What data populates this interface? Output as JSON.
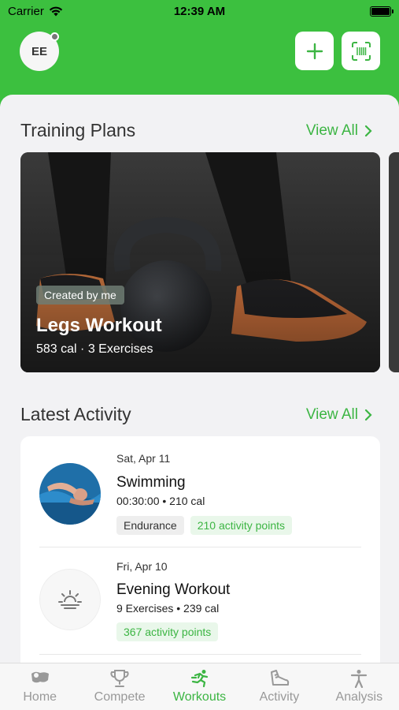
{
  "status_bar": {
    "carrier": "Carrier",
    "time": "12:39 AM"
  },
  "header": {
    "avatar_initials": "EE",
    "add_icon": "plus-icon",
    "scan_icon": "barcode-scan-icon"
  },
  "training_plans": {
    "title": "Training Plans",
    "view_all": "View All",
    "card": {
      "badge": "Created by me",
      "name": "Legs Workout",
      "meta": "583 cal · 3 Exercises"
    }
  },
  "latest_activity": {
    "title": "Latest Activity",
    "view_all": "View All",
    "items": [
      {
        "date": "Sat, Apr 11",
        "name": "Swimming",
        "meta": "00:30:00 • 210 cal",
        "tags": [
          "Endurance",
          "210 activity points"
        ]
      },
      {
        "date": "Fri, Apr 10",
        "name": "Evening Workout",
        "meta": "9 Exercises • 239 cal",
        "tags": [
          "367 activity points"
        ]
      }
    ]
  },
  "tabbar": {
    "active": "Workouts",
    "tabs": [
      {
        "label": "Home",
        "icon": "home-icon"
      },
      {
        "label": "Compete",
        "icon": "trophy-icon"
      },
      {
        "label": "Workouts",
        "icon": "running-icon"
      },
      {
        "label": "Activity",
        "icon": "shoe-icon"
      },
      {
        "label": "Analysis",
        "icon": "person-icon"
      }
    ]
  },
  "colors": {
    "brand_green": "#3cc03f",
    "accent_green": "#3cb543"
  }
}
